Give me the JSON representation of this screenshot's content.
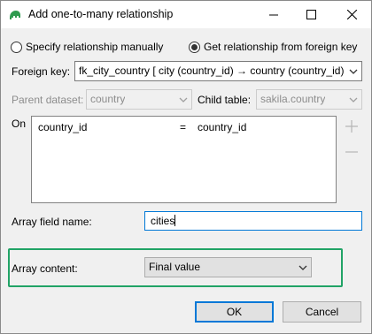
{
  "window": {
    "title": "Add one-to-many relationship"
  },
  "mode": {
    "manual_label": "Specify relationship manually",
    "foreign_key_label": "Get relationship from foreign key",
    "selected": "foreign_key"
  },
  "foreign_key": {
    "label": "Foreign key:",
    "value": "fk_city_country [ city (country_id) → country (country_id)"
  },
  "parent_dataset": {
    "label": "Parent dataset:",
    "value": "country"
  },
  "child_table": {
    "label": "Child table:",
    "value": "sakila.country"
  },
  "on": {
    "label": "On",
    "rows": [
      {
        "left": "country_id",
        "operator": "=",
        "right": "country_id"
      }
    ]
  },
  "array_field": {
    "label": "Array field name:",
    "value": "cities"
  },
  "array_content": {
    "label": "Array content:",
    "value": "Final value"
  },
  "buttons": {
    "ok": "OK",
    "cancel": "Cancel"
  },
  "colors": {
    "accent": "#0078d7",
    "highlight_border": "#21a366",
    "app_icon": "#2e9a4e"
  }
}
